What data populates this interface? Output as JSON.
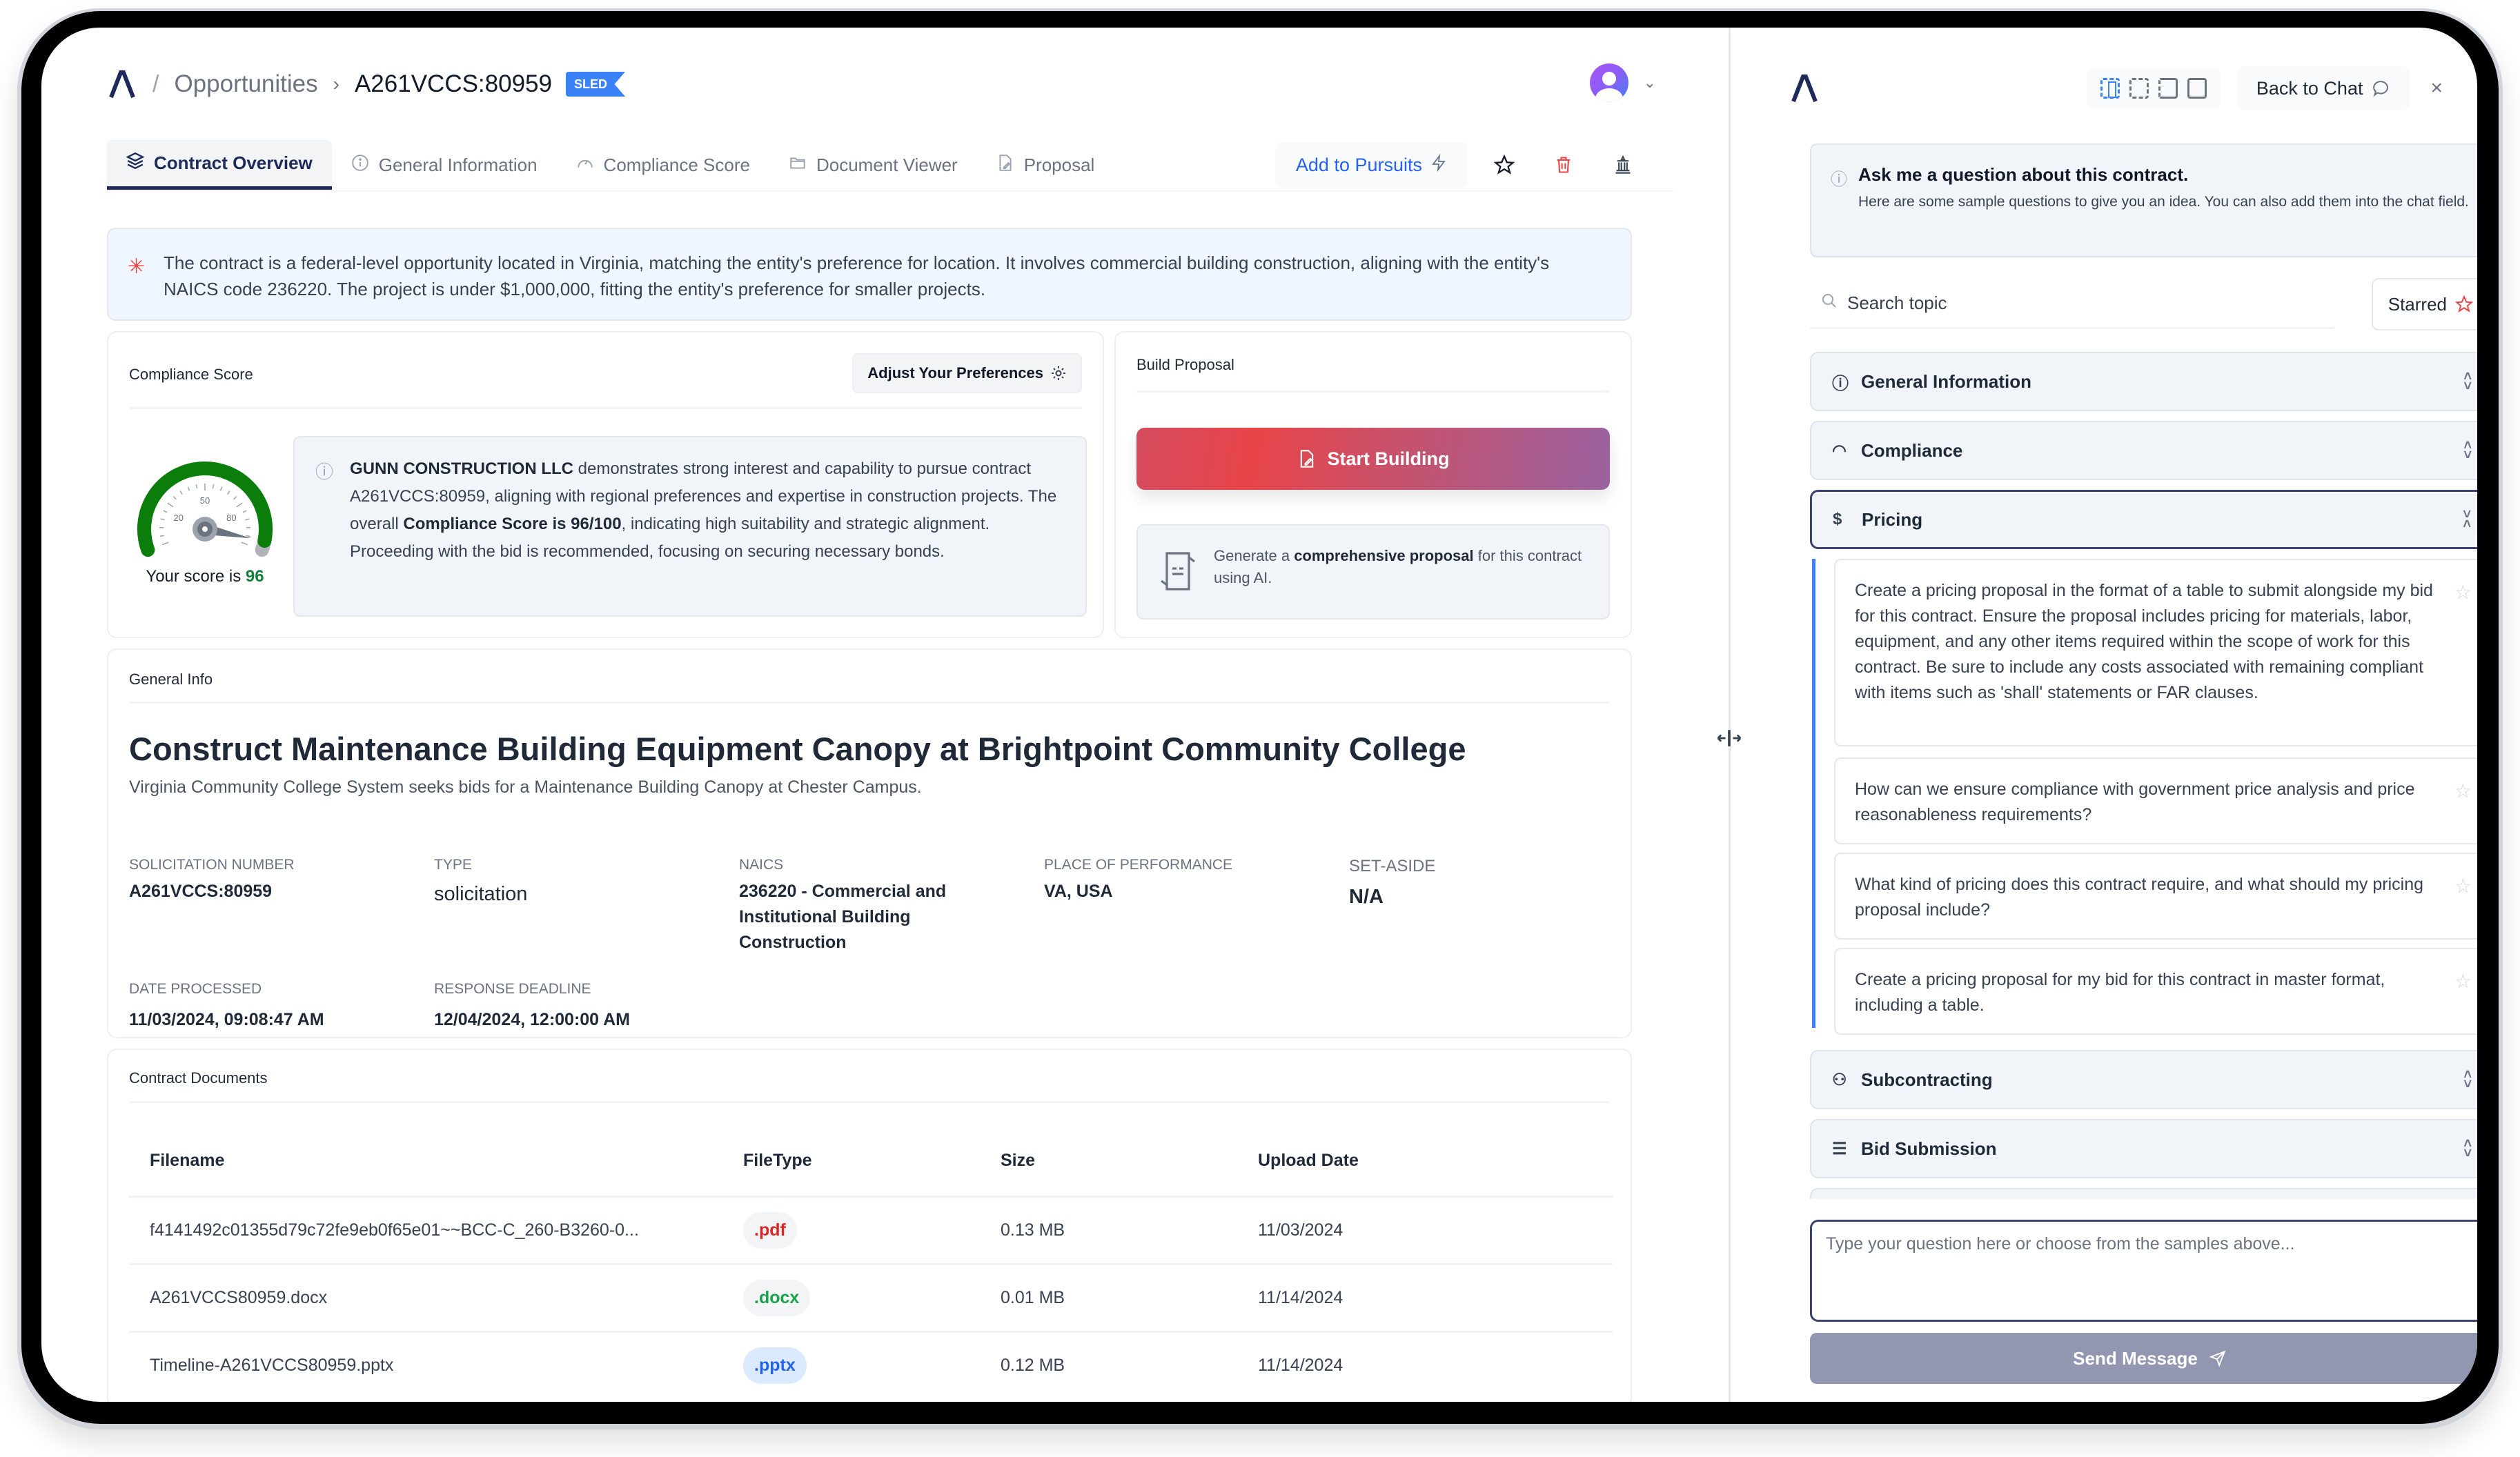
{
  "header": {
    "breadcrumb": {
      "separator": "/",
      "link": "Opportunities",
      "arrow": "›",
      "current": "A261VCCS:80959",
      "badge": "SLED"
    },
    "avatar_chevron": "⌄"
  },
  "tabs": [
    {
      "label": "Contract Overview",
      "icon": "layers-icon",
      "active": true
    },
    {
      "label": "General Information",
      "icon": "info-icon",
      "active": false
    },
    {
      "label": "Compliance Score",
      "icon": "gauge-icon",
      "active": false
    },
    {
      "label": "Document Viewer",
      "icon": "folder-icon",
      "active": false
    },
    {
      "label": "Proposal",
      "icon": "file-edit-icon",
      "active": false
    }
  ],
  "actions": {
    "add_to_pursuits": "Add to Pursuits"
  },
  "summary_banner": "The contract is a federal-level opportunity located in Virginia, matching the entity's preference for location. It involves commercial building construction, aligning with the entity's NAICS code 236220. The project is under $1,000,000, fitting the entity's preference for smaller projects.",
  "compliance": {
    "title": "Compliance Score",
    "adjust_label": "Adjust Your Preferences",
    "score": 96,
    "score_max": 100,
    "gauge_ticks": [
      "20",
      "50",
      "80"
    ],
    "score_prefix": "Your score is ",
    "score_value": "96",
    "desc_company": "GUNN CONSTRUCTION LLC",
    "desc_part1": " demonstrates strong interest and capability to pursue contract A261VCCS:80959, aligning with regional preferences and expertise in construction projects. The overall ",
    "desc_bold": "Compliance Score is 96/100",
    "desc_part2": ", indicating high suitability and strategic alignment. Proceeding with the bid is recommended, focusing on securing necessary bonds.",
    "colors": {
      "gauge": "#0a7d0a",
      "score_text": "#15803d"
    }
  },
  "build_proposal": {
    "title": "Build Proposal",
    "start_label": "Start Building",
    "gen_prefix": "Generate a ",
    "gen_bold": "comprehensive proposal",
    "gen_suffix": " for this contract using AI."
  },
  "general_info": {
    "section_label": "General Info",
    "title": "Construct Maintenance Building Equipment Canopy at Brightpoint Community College",
    "subtitle": "Virginia Community College System seeks bids for a Maintenance Building Canopy at Chester Campus.",
    "fields": {
      "solicitation_number": {
        "label": "Solicitation Number",
        "value": "A261VCCS:80959"
      },
      "type": {
        "label": "Type",
        "value": "solicitation"
      },
      "naics": {
        "label": "NAICS",
        "value": "236220 - Commercial and Institutional Building Construction"
      },
      "place": {
        "label": "Place of Performance",
        "value": "VA, USA"
      },
      "set_aside": {
        "label": "Set-Aside",
        "value": "N/A"
      },
      "date_processed": {
        "label": "Date Processed",
        "value": "11/03/2024, 09:08:47 AM"
      },
      "response_deadline": {
        "label": "Response Deadline",
        "value": "12/04/2024, 12:00:00 AM"
      }
    }
  },
  "documents": {
    "title": "Contract Documents",
    "columns": [
      "Filename",
      "FileType",
      "Size",
      "Upload Date"
    ],
    "rows": [
      {
        "filename": "f4141492c01355d79c72fe9eb0f65e01~~BCC-C_260-B3260-0...",
        "filetype": ".pdf",
        "size": "0.13 MB",
        "date": "11/03/2024",
        "color": "#dc2626",
        "bg": "#f3f4f6"
      },
      {
        "filename": "A261VCCS80959.docx",
        "filetype": ".docx",
        "size": "0.01 MB",
        "date": "11/14/2024",
        "color": "#16a34a",
        "bg": "#f3f4f6"
      },
      {
        "filename": "Timeline-A261VCCS80959.pptx",
        "filetype": ".pptx",
        "size": "0.12 MB",
        "date": "11/14/2024",
        "color": "#2563eb",
        "bg": "#dbeafe"
      }
    ]
  },
  "chat": {
    "back_label": "Back to Chat",
    "close": "×",
    "ask_title": "Ask me a question about this contract.",
    "ask_sub": "Here are some sample questions to give you an idea. You can also add them into the chat field.",
    "search_placeholder": "Search topic",
    "starred_label": "Starred",
    "sections": [
      {
        "label": "General Information",
        "icon": "ⓘ",
        "open": false
      },
      {
        "label": "Compliance",
        "icon": "◠",
        "open": false
      },
      {
        "label": "Pricing",
        "icon": "$",
        "open": true
      },
      {
        "label": "Subcontracting",
        "icon": "⚇",
        "open": false
      },
      {
        "label": "Bid Submission",
        "icon": "☰",
        "open": false
      }
    ],
    "pricing_questions": [
      "Create a pricing proposal in the format of a table to submit alongside my bid for this contract. Ensure the proposal includes pricing for materials, labor, equipment, and any other items required within the scope of work for this contract. Be sure to include any costs associated with remaining compliant with items such as 'shall' statements or FAR clauses.",
      "How can we ensure compliance with government price analysis and price reasonableness requirements?",
      "What kind of pricing does this contract require, and what should my pricing proposal include?",
      "Create a pricing proposal for my bid for this contract in master format, including a table."
    ],
    "input_placeholder": "Type your question here or choose from the samples above...",
    "send_label": "Send Message"
  }
}
